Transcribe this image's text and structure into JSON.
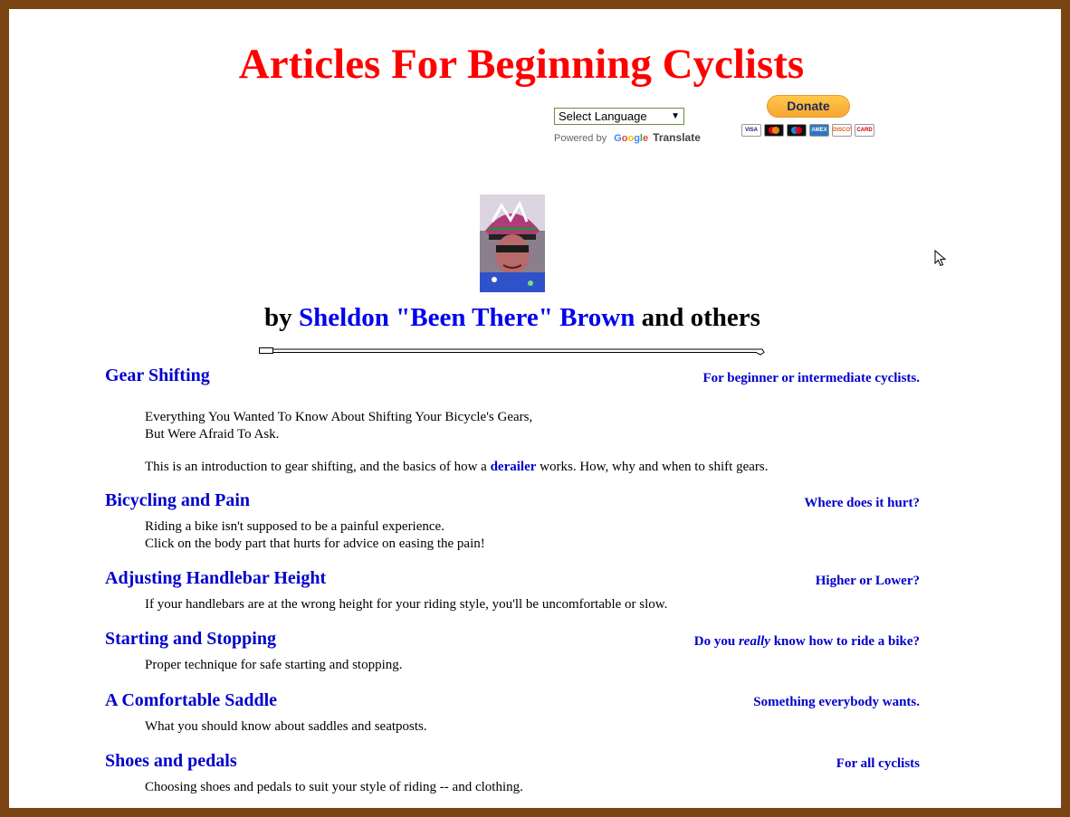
{
  "header": {
    "title": "Articles For Beginning Cyclists",
    "language_select": "Select Language",
    "powered_by": "Powered by",
    "google": [
      "G",
      "o",
      "o",
      "g",
      "l",
      "e"
    ],
    "translate": "Translate",
    "donate": "Donate",
    "cards": [
      "VISA",
      "MC",
      "MAESTRO",
      "AMEX",
      "DISCOVER",
      "CARD"
    ]
  },
  "byline": {
    "prefix": "by",
    "author": "Sheldon \"Been There\" Brown",
    "suffix": "and others"
  },
  "articles": [
    {
      "title": "Gear Shifting",
      "tag": "For beginner or intermediate cyclists.",
      "line1": "Everything You Wanted To Know About Shifting Your Bicycle's Gears,",
      "line2": "But Were Afraid To Ask.",
      "line3_before": "This is an introduction to gear shifting, and the basics of how a",
      "line3_link": "derailer",
      "line3_after": "works. How, why and when to shift gears."
    },
    {
      "title": "Bicycling and Pain",
      "tag": "Where does it hurt?",
      "line1": "Riding a bike isn't supposed to be a painful experience.",
      "line2": "Click on the body part that hurts for advice on easing the pain!"
    },
    {
      "title": "Adjusting Handlebar Height",
      "tag": "Higher or Lower?",
      "line1": "If your handlebars are at the wrong height for your riding style, you'll be uncomfortable or slow."
    },
    {
      "title": "Starting and Stopping",
      "tag_before": "Do you",
      "tag_em": "really",
      "tag_after": "know how to ride a bike?",
      "line1": "Proper technique for safe starting and stopping."
    },
    {
      "title": "A Comfortable Saddle",
      "tag": "Something everybody wants.",
      "line1": "What you should know about saddles and seatposts."
    },
    {
      "title": "Shoes and pedals",
      "tag": "For all cyclists",
      "line1": "Choosing shoes and pedals to suit your style of riding -- and clothing."
    }
  ],
  "colors": {
    "frame": "#7a4512",
    "title_red": "#ff0000",
    "link_blue": "#0000cc"
  }
}
